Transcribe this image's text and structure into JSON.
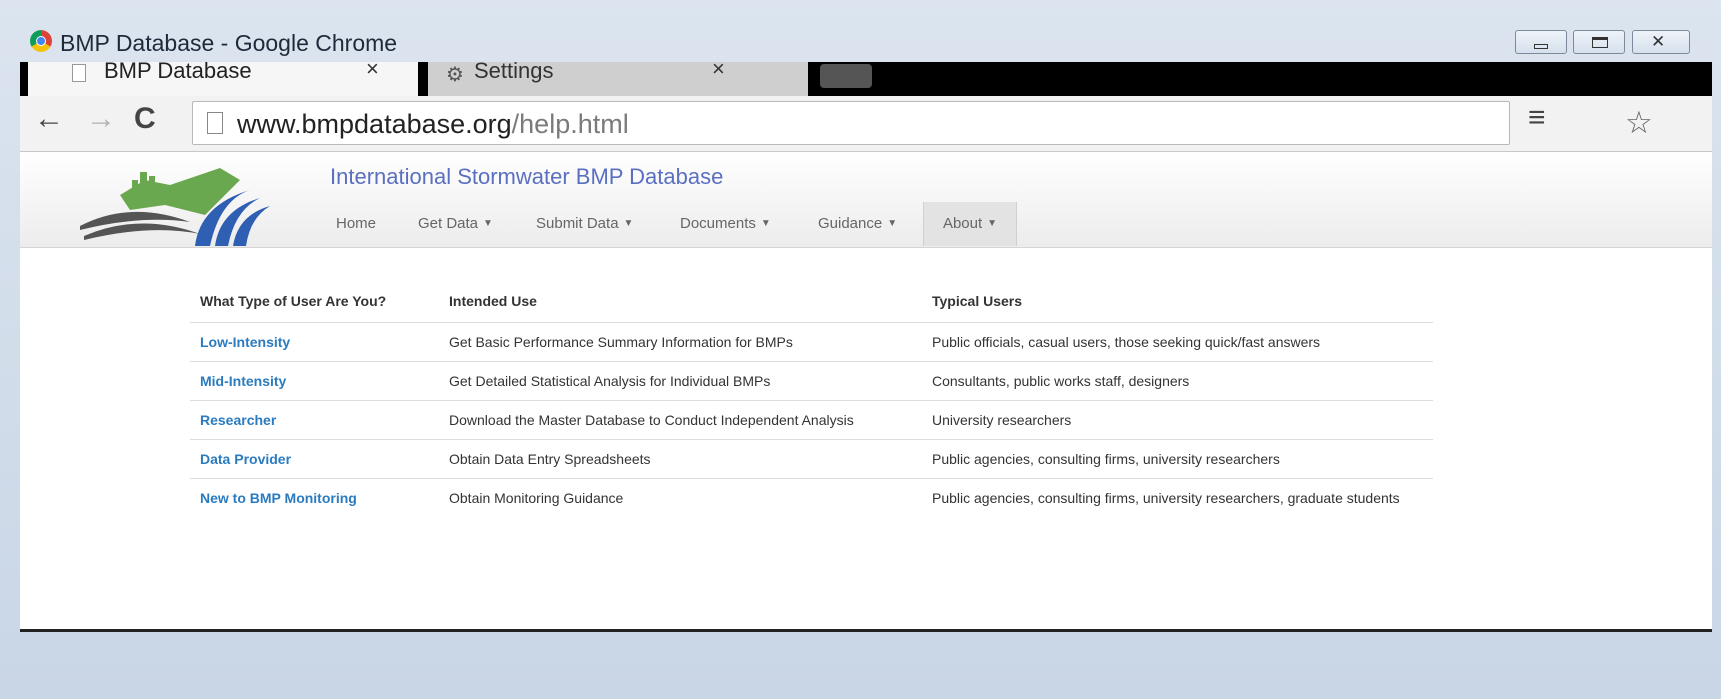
{
  "window": {
    "title": "BMP Database - Google Chrome"
  },
  "tabs": [
    {
      "label": "BMP Database",
      "active": true,
      "icon": "page-icon"
    },
    {
      "label": "Settings",
      "active": false,
      "icon": "gear-icon"
    }
  ],
  "toolbar": {
    "url_host": "www.bmpdatabase.org",
    "url_path": "/help.html"
  },
  "site": {
    "title": "International Stormwater BMP Database",
    "nav": [
      {
        "label": "Home",
        "dropdown": false
      },
      {
        "label": "Get Data",
        "dropdown": true
      },
      {
        "label": "Submit Data",
        "dropdown": true
      },
      {
        "label": "Documents",
        "dropdown": true
      },
      {
        "label": "Guidance",
        "dropdown": true
      },
      {
        "label": "About",
        "dropdown": true,
        "active": true
      }
    ]
  },
  "table": {
    "headers": [
      "What Type of User Are You?",
      "Intended Use",
      "Typical Users"
    ],
    "rows": [
      {
        "type": "Low-Intensity",
        "use": "Get Basic Performance Summary Information for BMPs",
        "users": "Public officials, casual users, those seeking quick/fast answers"
      },
      {
        "type": "Mid-Intensity",
        "use": "Get Detailed Statistical Analysis for Individual BMPs",
        "users": "Consultants, public works staff, designers"
      },
      {
        "type": "Researcher",
        "use": "Download the Master Database to Conduct Independent Analysis",
        "users": "University researchers"
      },
      {
        "type": "Data Provider",
        "use": "Obtain Data Entry Spreadsheets",
        "users": "Public agencies, consulting firms, university researchers"
      },
      {
        "type": "New to BMP Monitoring",
        "use": "Obtain Monitoring Guidance",
        "users": "Public agencies, consulting firms, university researchers, graduate students"
      }
    ]
  },
  "colors": {
    "link": "#2a7bc0",
    "site_title": "#5a6fc0"
  }
}
